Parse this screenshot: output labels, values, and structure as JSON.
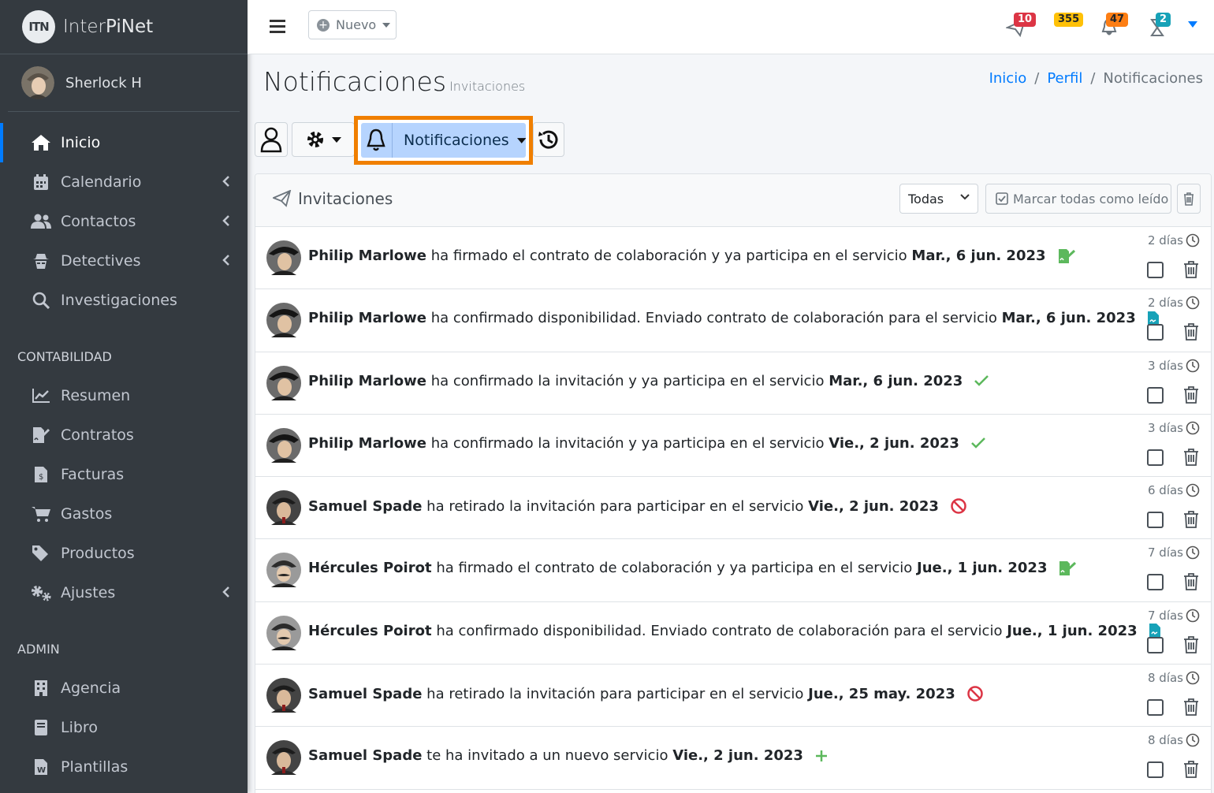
{
  "brand": {
    "logo_text": "ITN",
    "name_part1": "Inter",
    "name_part2": "PiNet"
  },
  "user": {
    "name": "Sherlock H"
  },
  "nav": {
    "items": [
      {
        "label": "Inicio",
        "icon": "home-icon",
        "active": true
      },
      {
        "label": "Calendario",
        "icon": "calendar-icon",
        "has_children": true
      },
      {
        "label": "Contactos",
        "icon": "users-icon",
        "has_children": true
      },
      {
        "label": "Detectives",
        "icon": "detective-icon",
        "has_children": true
      },
      {
        "label": "Investigaciones",
        "icon": "search-icon"
      }
    ],
    "contabilidad_header": "CONTABILIDAD",
    "contabilidad": [
      {
        "label": "Resumen",
        "icon": "chart-line-icon"
      },
      {
        "label": "Contratos",
        "icon": "file-signature-icon"
      },
      {
        "label": "Facturas",
        "icon": "invoice-icon"
      },
      {
        "label": "Gastos",
        "icon": "cart-icon"
      },
      {
        "label": "Productos",
        "icon": "tags-icon"
      },
      {
        "label": "Ajustes",
        "icon": "cogs-icon",
        "has_children": true
      }
    ],
    "admin_header": "ADMIN",
    "admin": [
      {
        "label": "Agencia",
        "icon": "building-icon"
      },
      {
        "label": "Libro",
        "icon": "book-icon"
      },
      {
        "label": "Plantillas",
        "icon": "word-file-icon"
      }
    ]
  },
  "topbar": {
    "nuevo_label": "Nuevo",
    "badges": {
      "messages": "10",
      "mail": "355",
      "bell": "47",
      "tasks": "2"
    }
  },
  "header": {
    "title": "Notificaciones",
    "subtitle": "Invitaciones",
    "breadcrumb": [
      "Inicio",
      "Perfil",
      "Notificaciones"
    ]
  },
  "toolbar": {
    "notifications_label": "Notificaciones"
  },
  "card": {
    "title": "Invitaciones",
    "filter_value": "Todas",
    "mark_all_label": "Marcar todas como leído"
  },
  "notifications": [
    {
      "name": "Philip Marlowe",
      "text": " ha firmado el contrato de colaboración y ya participa en el servicio ",
      "date": "Mar., 6 jun. 2023",
      "status": "signed",
      "time": "2 días"
    },
    {
      "name": "Philip Marlowe",
      "text": " ha confirmado disponibilidad. Enviado contrato de colaboración para el servicio ",
      "date": "Mar., 6 jun. 2023",
      "status": "contract",
      "time": "2 días"
    },
    {
      "name": "Philip Marlowe",
      "text": " ha confirmado la invitación y ya participa en el servicio ",
      "date": "Mar., 6 jun. 2023",
      "status": "check",
      "time": "3 días"
    },
    {
      "name": "Philip Marlowe",
      "text": " ha confirmado la invitación y ya participa en el servicio ",
      "date": "Vie., 2 jun. 2023",
      "status": "check",
      "time": "3 días"
    },
    {
      "name": "Samuel Spade",
      "text": " ha retirado la invitación para participar en el servicio ",
      "date": "Vie., 2 jun. 2023",
      "status": "ban",
      "time": "6 días"
    },
    {
      "name": "Hércules Poirot",
      "text": " ha firmado el contrato de colaboración y ya participa en el servicio ",
      "date": "Jue., 1 jun. 2023",
      "status": "signed",
      "time": "7 días"
    },
    {
      "name": "Hércules Poirot",
      "text": " ha confirmado disponibilidad. Enviado contrato de colaboración para el servicio ",
      "date": "Jue., 1 jun. 2023",
      "status": "contract",
      "time": "7 días"
    },
    {
      "name": "Samuel Spade",
      "text": " ha retirado la invitación para participar en el servicio ",
      "date": "Jue., 25 may. 2023",
      "status": "ban",
      "time": "8 días"
    },
    {
      "name": "Samuel Spade",
      "text": " te ha invitado a un nuevo servicio ",
      "date": "Vie., 2 jun. 2023",
      "status": "plus",
      "time": "8 días"
    }
  ],
  "colors": {
    "sidebar": "#343a40",
    "accent": "#007bff",
    "highlight": "#f07f00",
    "success": "#5cb85c",
    "danger": "#dc3545",
    "info": "#17a2b8"
  }
}
